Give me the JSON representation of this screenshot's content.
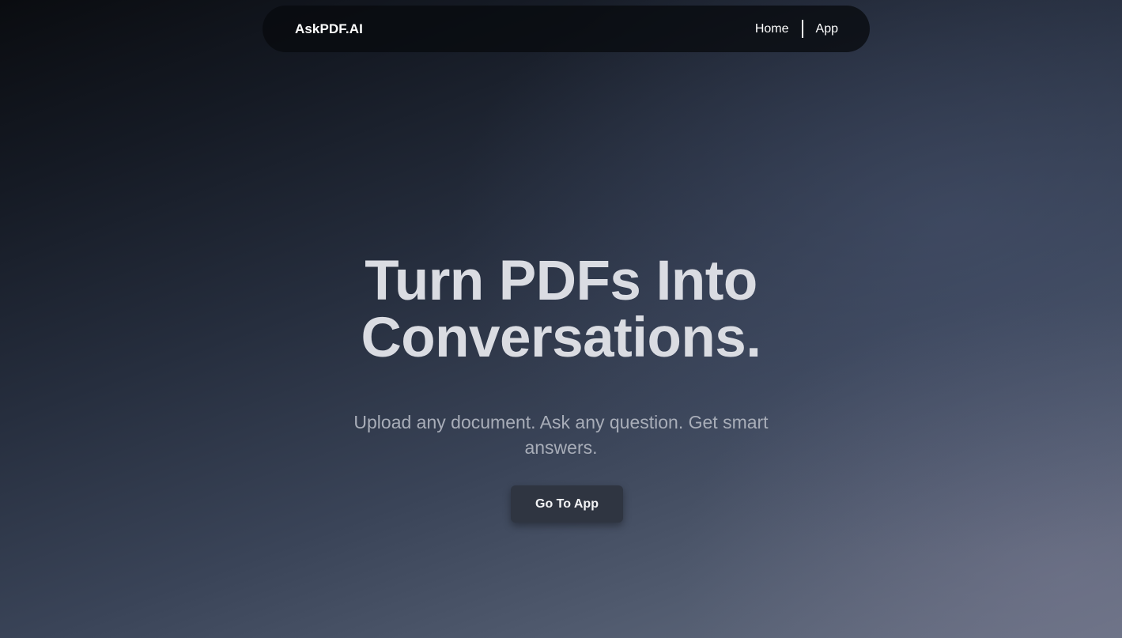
{
  "navbar": {
    "brand": "AskPDF.AI",
    "links": [
      {
        "label": "Home"
      },
      {
        "label": "App"
      }
    ]
  },
  "hero": {
    "title_line1": "Turn PDFs Into",
    "title_line2": "Conversations.",
    "subtitle": "Upload any document. Ask any question. Get smart answers.",
    "cta_label": "Go To App"
  },
  "colors": {
    "background_dark": "#0a0c10",
    "background_light": "#6a7284",
    "title": "#dadce2",
    "subtitle": "#a8adb8",
    "button": "#2f3541"
  }
}
